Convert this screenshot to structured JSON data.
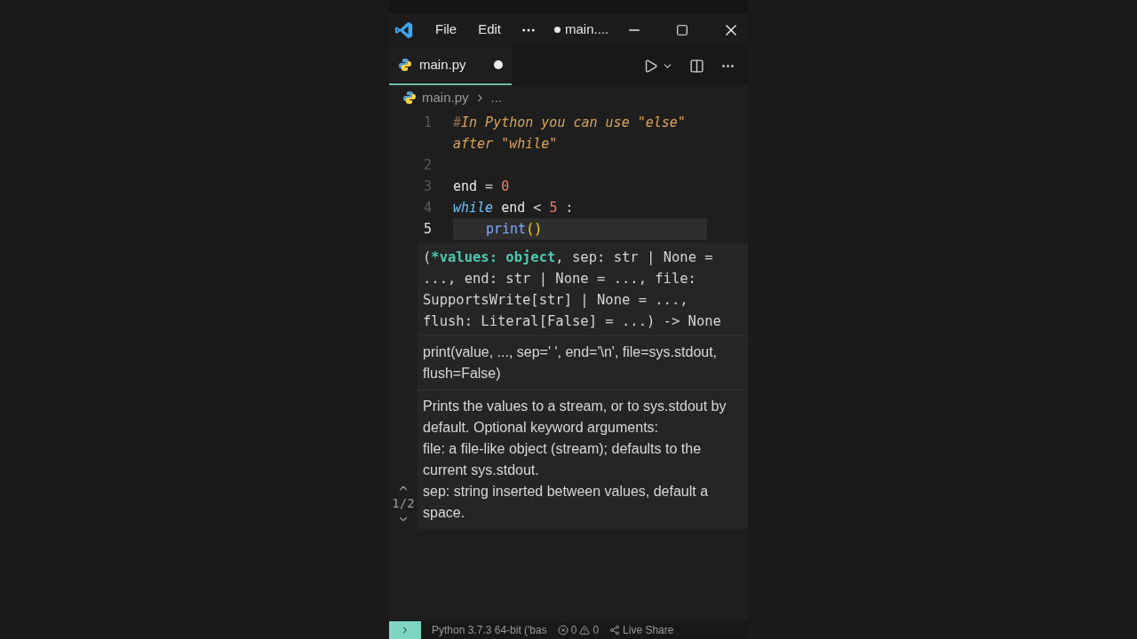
{
  "title_bar": {
    "menu": [
      "File",
      "Edit"
    ],
    "title": "main....",
    "dirty": true
  },
  "tab": {
    "label": "main.py",
    "modified": true,
    "selected": true
  },
  "breadcrumb": [
    "main.py",
    "..."
  ],
  "code_lines": [
    {
      "number": "1",
      "current": false,
      "tokens": [
        {
          "kind": "comment-mark",
          "text": "#"
        },
        {
          "kind": "comment",
          "text": "In Python you can use \"else\" after \"while\""
        }
      ]
    },
    {
      "number": "2",
      "current": false
    },
    {
      "number": "3",
      "current": false,
      "tokens": [
        {
          "kind": "ident",
          "text": "end"
        },
        {
          "kind": "op",
          "text": " = "
        },
        {
          "kind": "number",
          "text": "0"
        }
      ]
    },
    {
      "number": "4",
      "current": false,
      "tokens": [
        {
          "kind": "keyword",
          "text": "while"
        },
        {
          "kind": "ident",
          "text": " end"
        },
        {
          "kind": "op",
          "text": " < "
        },
        {
          "kind": "number",
          "text": "5"
        },
        {
          "kind": "op",
          "text": " :"
        }
      ]
    },
    {
      "number": "5",
      "current": true,
      "indented": true,
      "tokens": [
        {
          "kind": "func",
          "text": "print"
        },
        {
          "kind": "paren",
          "text": "()"
        }
      ]
    }
  ],
  "signature_help": {
    "before": "(",
    "active_param": "*values: object",
    "after": ", sep: str | None = ..., end: str | None = ..., file: SupportsWrite[str] | None = ..., flush: Literal[False] = ...) -> None",
    "overload": "1/2",
    "doc": [
      "print(value, ..., sep=' ', end='\\n', file=sys.stdout, flush=False)"
    ],
    "description": [
      "Prints the values to a stream, or to sys.stdout by default. Optional keyword arguments:",
      "file: a file-like object (stream); defaults to the current sys.stdout.",
      "sep: string inserted between values, default a space."
    ]
  },
  "status_bar": {
    "interpreter": "Python 3.7.3 64-bit ('bas",
    "errors": "0",
    "warnings": "0",
    "live_share": "Live Share"
  }
}
